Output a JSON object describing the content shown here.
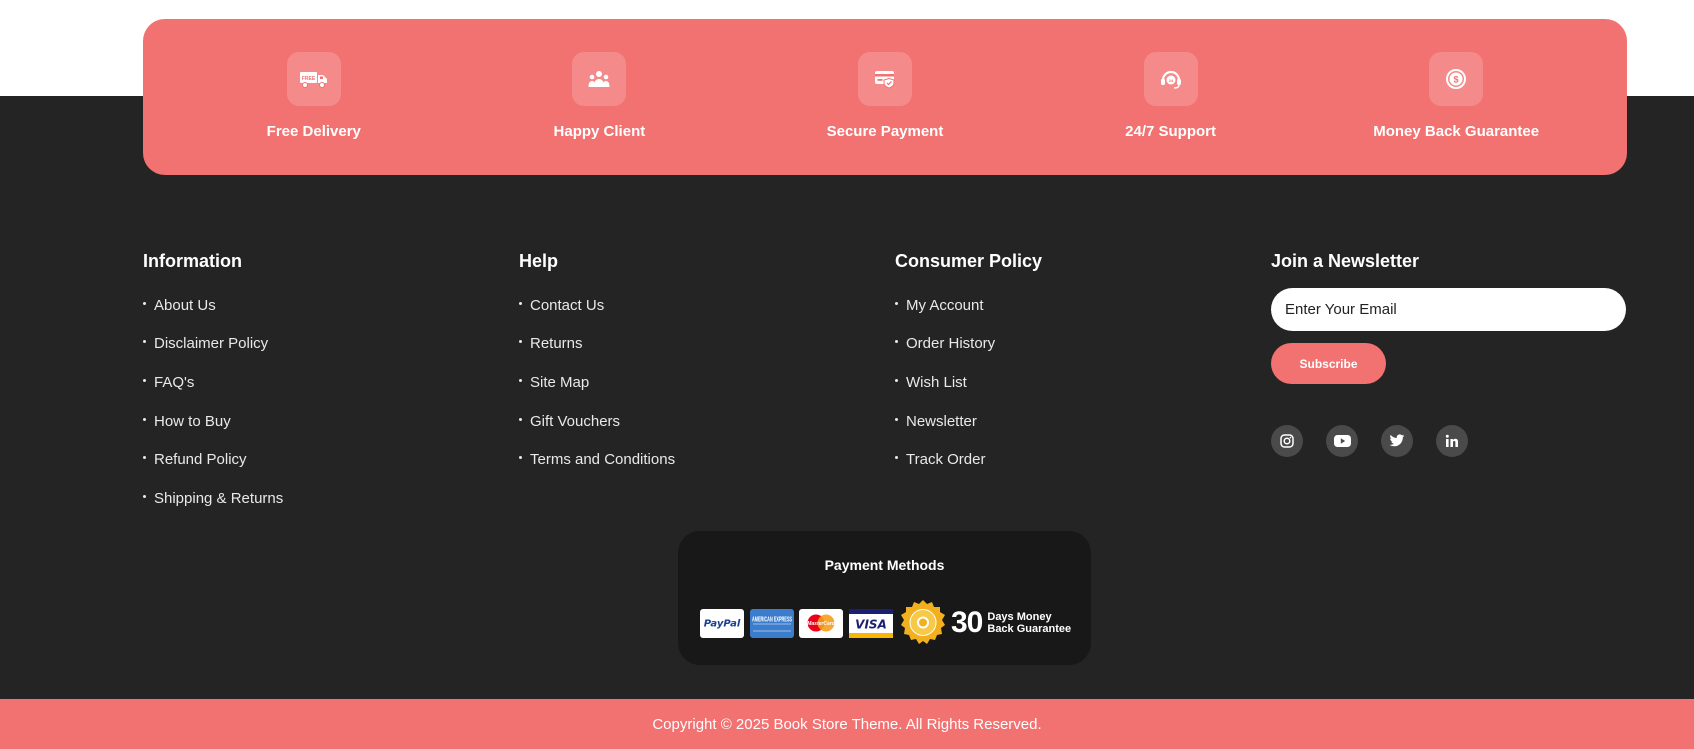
{
  "features": [
    {
      "label": "Free Delivery",
      "icon": "delivery-truck-icon"
    },
    {
      "label": "Happy Client",
      "icon": "happy-client-icon"
    },
    {
      "label": "Secure Payment",
      "icon": "secure-payment-icon"
    },
    {
      "label": "24/7 Support",
      "icon": "support-headset-icon"
    },
    {
      "label": "Money Back Guarantee",
      "icon": "money-back-icon"
    }
  ],
  "columns": [
    {
      "title": "Information",
      "links": [
        "About Us",
        "Disclaimer Policy",
        "FAQ's",
        "How to Buy",
        "Refund Policy",
        "Shipping & Returns"
      ]
    },
    {
      "title": "Help",
      "links": [
        "Contact Us",
        "Returns",
        "Site Map",
        "Gift Vouchers",
        "Terms and Conditions"
      ]
    },
    {
      "title": "Consumer Policy",
      "links": [
        "My Account",
        "Order History",
        "Wish List",
        "Newsletter",
        "Track Order"
      ]
    }
  ],
  "newsletter": {
    "title": "Join a Newsletter",
    "placeholder": "Enter Your Email",
    "button": "Subscribe",
    "socials": [
      "instagram-icon",
      "youtube-icon",
      "twitter-icon",
      "linkedin-icon"
    ]
  },
  "payment": {
    "title": "Payment Methods",
    "cards": [
      "PayPal",
      "AMERICAN EXPRESS",
      "MasterCard",
      "VISA"
    ],
    "guarantee_number": "30",
    "guarantee_line1": "Days Money",
    "guarantee_line2": "Back Guarantee"
  },
  "copyright": "Copyright © 2025 Book Store Theme. All Rights Reserved.",
  "colors": {
    "accent": "#f27171",
    "footer_bg": "#242424",
    "payment_bg": "#181818",
    "social_bg": "#4a4a4a"
  }
}
